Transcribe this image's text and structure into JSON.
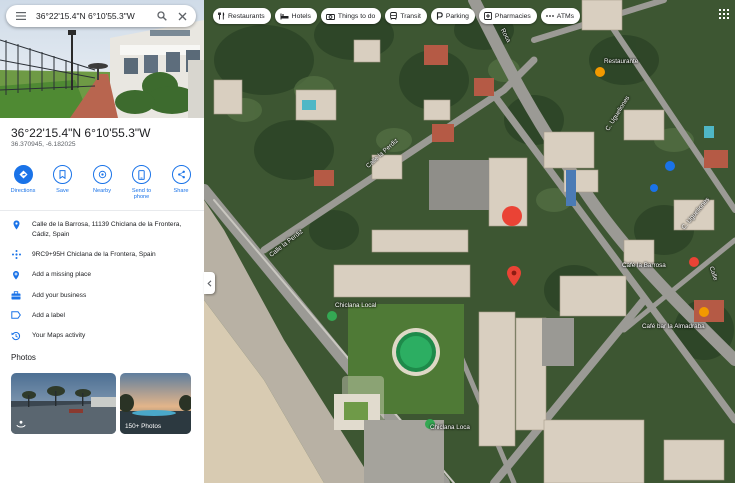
{
  "search": {
    "query": "36°22'15.4\"N 6°10'55.3\"W"
  },
  "place": {
    "title": "36°22'15.4\"N 6°10'55.3\"W",
    "coords": "36.370945, -6.182025"
  },
  "actions": [
    {
      "label": "Directions",
      "icon": "directions-icon"
    },
    {
      "label": "Save",
      "icon": "bookmark-icon"
    },
    {
      "label": "Nearby",
      "icon": "nearby-icon"
    },
    {
      "label": "Send to phone",
      "icon": "phone-icon"
    },
    {
      "label": "Share",
      "icon": "share-icon"
    }
  ],
  "info": {
    "address": "Calle de la Barrosa, 11139 Chiclana de la Frontera, Cádiz, Spain",
    "plus_code": "9RC9+95H Chiclana de la Frontera, Spain",
    "add_missing_place": "Add a missing place",
    "add_business": "Add your business",
    "add_label": "Add a label",
    "maps_activity": "Your Maps activity"
  },
  "photos": {
    "heading": "Photos",
    "more_badge": "150+ Photos"
  },
  "chips": [
    {
      "label": "Restaurants",
      "icon": "restaurant-icon"
    },
    {
      "label": "Hotels",
      "icon": "hotel-icon"
    },
    {
      "label": "Things to do",
      "icon": "camera-icon"
    },
    {
      "label": "Transit",
      "icon": "transit-icon"
    },
    {
      "label": "Parking",
      "icon": "parking-icon"
    },
    {
      "label": "Pharmacies",
      "icon": "pharmacy-icon"
    },
    {
      "label": "ATMs",
      "icon": "atm-icon"
    }
  ],
  "map_labels": {
    "calle_la_perdiz_1": "Calle la Perdiz",
    "calle_la_perdiz_2": "Calle la Perdiz",
    "road_top": "Roca",
    "uguelones_1": "C. Ugueliones",
    "uguelones_2": "C. Ugueliones",
    "cafe_barrosa": "Café la Barrosa",
    "cafe_almadraba": "Café bar la Almadraba",
    "calle_side": "Calle",
    "chiclana_area": "Chiclana Local",
    "bottom_label": "Chiclana Loca",
    "place_top_right": "Restaurante"
  },
  "colors": {
    "accent": "#1a73e8",
    "pin": "#ea4335",
    "text_primary": "#202124",
    "text_secondary": "#5f6368"
  }
}
